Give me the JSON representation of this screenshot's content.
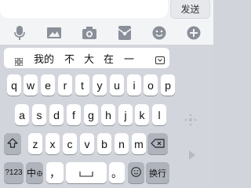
{
  "input": {
    "value": "",
    "send_label": "发送"
  },
  "toolbar": {
    "icons": [
      "microphone-icon",
      "image-icon",
      "camera-icon",
      "red-packet-icon",
      "emoji-icon",
      "plus-icon"
    ]
  },
  "suggestions": [
    "我的",
    "不",
    "大",
    "在",
    "一"
  ],
  "keyboard": {
    "row1": [
      "q",
      "w",
      "e",
      "r",
      "t",
      "y",
      "u",
      "i",
      "o",
      "p"
    ],
    "row2": [
      "a",
      "s",
      "d",
      "f",
      "g",
      "h",
      "j",
      "k",
      "l"
    ],
    "row3": [
      "z",
      "x",
      "c",
      "v",
      "b",
      "n",
      "m"
    ],
    "num_label": "?123",
    "lang_label": "中",
    "comma": "，",
    "period": "。",
    "return_label": "换行"
  },
  "colors": {
    "keyboard_bg": "#d2d5db",
    "key": "#ffffff",
    "func_key": "#aeb3bc",
    "toolbar_icon": "#8a8f99"
  }
}
